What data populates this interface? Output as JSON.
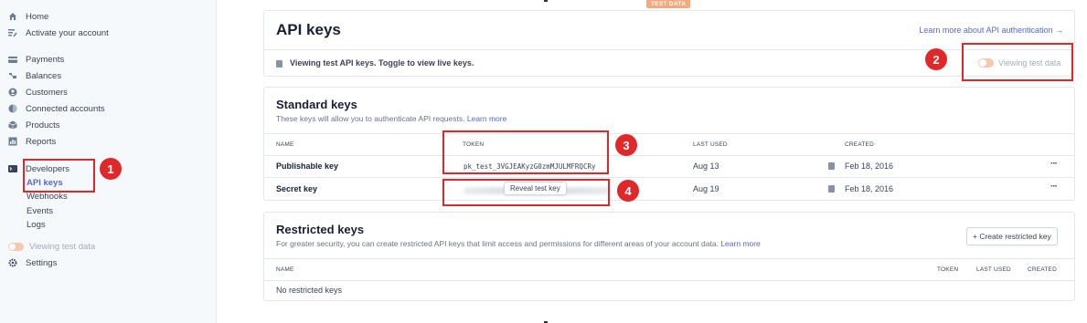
{
  "sidebar": {
    "items": [
      {
        "label": "Home",
        "icon": "home-icon"
      },
      {
        "label": "Activate your account",
        "icon": "activate-icon"
      },
      {
        "label": "Payments",
        "icon": "payments-icon"
      },
      {
        "label": "Balances",
        "icon": "balances-icon"
      },
      {
        "label": "Customers",
        "icon": "customers-icon"
      },
      {
        "label": "Connected accounts",
        "icon": "connected-accounts-icon"
      },
      {
        "label": "Products",
        "icon": "products-icon"
      },
      {
        "label": "Reports",
        "icon": "reports-icon"
      },
      {
        "label": "Developers",
        "icon": "terminal-icon"
      }
    ],
    "developers_sub": [
      "API keys",
      "Webhooks",
      "Events",
      "Logs"
    ],
    "toggle_label": "Viewing test data",
    "settings_label": "Settings"
  },
  "header": {
    "test_badge": "TEST DATA"
  },
  "api_keys": {
    "title": "API keys",
    "learn_link": "Learn more about API authentication →",
    "banner_text": "Viewing test API keys. Toggle to view live keys.",
    "toggle_label": "Viewing test data"
  },
  "standard_keys": {
    "title": "Standard keys",
    "description": "These keys will allow you to authenticate API requests.",
    "learn_link": "Learn more",
    "columns": [
      "NAME",
      "TOKEN",
      "LAST USED",
      "CREATED"
    ],
    "rows": [
      {
        "name": "Publishable key",
        "token": "pk_test_3VGJEAKyzG0zmMJULMFRQCRy",
        "last_used": "Aug 13",
        "created": "Feb 18, 2016"
      },
      {
        "name": "Secret key",
        "token_button": "Reveal test key",
        "last_used": "Aug 19",
        "created": "Feb 18, 2016"
      }
    ]
  },
  "restricted_keys": {
    "title": "Restricted keys",
    "description": "For greater security, you can create restricted API keys that limit access and permissions for different areas of your account data.",
    "learn_link": "Learn more",
    "create_button": "Create restricted key",
    "columns": [
      "NAME",
      "TOKEN",
      "LAST USED",
      "CREATED"
    ],
    "empty_text": "No restricted keys"
  },
  "annotations": [
    "1",
    "2",
    "3",
    "4"
  ],
  "colors": {
    "accent": "#5469d4",
    "annotation": "#e0282b",
    "test_badge": "#f5a97f"
  }
}
